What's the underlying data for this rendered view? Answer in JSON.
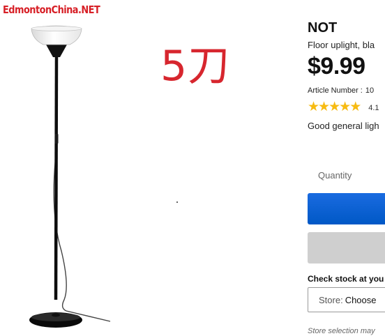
{
  "watermark": "EdmontonChina.NET",
  "overlay_text": "5刀",
  "product": {
    "name": "NOT",
    "description": "Floor uplight, bla",
    "price": "$9.99",
    "article_label": "Article Number :",
    "article_number": "10",
    "rating": {
      "stars": 5,
      "value": "4.1"
    },
    "summary": "Good general ligh"
  },
  "purchase": {
    "quantity_label": "Quantity",
    "buy_button_label": "",
    "shopping_list_button_label": ""
  },
  "stock": {
    "title": "Check stock at you",
    "store_label": "Store:",
    "store_value": "Choose",
    "hint": "Store selection may"
  },
  "colors": {
    "accent_blue": "#0058c6",
    "star_yellow": "#f7bb12",
    "overlay_red": "#d7262e",
    "button_gray": "#cfcfcf"
  },
  "icons": {
    "product_image": "floor-lamp-image",
    "rating": "star-icon"
  }
}
